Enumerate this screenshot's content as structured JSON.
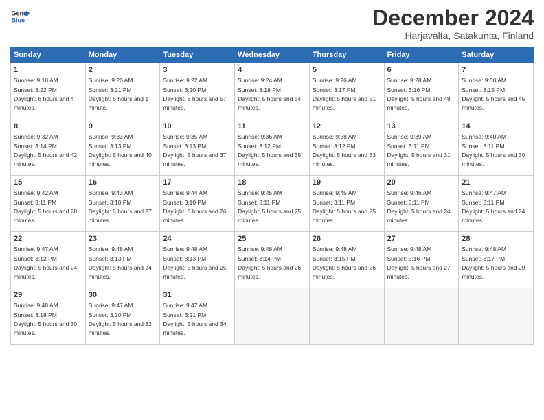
{
  "header": {
    "logo_line1": "General",
    "logo_line2": "Blue",
    "month_title": "December 2024",
    "location": "Harjavalta, Satakunta, Finland"
  },
  "calendar": {
    "weekdays": [
      "Sunday",
      "Monday",
      "Tuesday",
      "Wednesday",
      "Thursday",
      "Friday",
      "Saturday"
    ],
    "weeks": [
      [
        {
          "day": "1",
          "sunrise": "9:18 AM",
          "sunset": "3:22 PM",
          "daylight": "6 hours and 4 minutes."
        },
        {
          "day": "2",
          "sunrise": "9:20 AM",
          "sunset": "3:21 PM",
          "daylight": "6 hours and 1 minute."
        },
        {
          "day": "3",
          "sunrise": "9:22 AM",
          "sunset": "3:20 PM",
          "daylight": "5 hours and 57 minutes."
        },
        {
          "day": "4",
          "sunrise": "9:24 AM",
          "sunset": "3:18 PM",
          "daylight": "5 hours and 54 minutes."
        },
        {
          "day": "5",
          "sunrise": "9:26 AM",
          "sunset": "3:17 PM",
          "daylight": "5 hours and 51 minutes."
        },
        {
          "day": "6",
          "sunrise": "9:28 AM",
          "sunset": "3:16 PM",
          "daylight": "5 hours and 48 minutes."
        },
        {
          "day": "7",
          "sunrise": "9:30 AM",
          "sunset": "3:15 PM",
          "daylight": "5 hours and 45 minutes."
        }
      ],
      [
        {
          "day": "8",
          "sunrise": "9:32 AM",
          "sunset": "3:14 PM",
          "daylight": "5 hours and 42 minutes."
        },
        {
          "day": "9",
          "sunrise": "9:33 AM",
          "sunset": "3:13 PM",
          "daylight": "5 hours and 40 minutes."
        },
        {
          "day": "10",
          "sunrise": "9:35 AM",
          "sunset": "3:13 PM",
          "daylight": "5 hours and 37 minutes."
        },
        {
          "day": "11",
          "sunrise": "9:36 AM",
          "sunset": "3:12 PM",
          "daylight": "5 hours and 35 minutes."
        },
        {
          "day": "12",
          "sunrise": "9:38 AM",
          "sunset": "3:12 PM",
          "daylight": "5 hours and 33 minutes."
        },
        {
          "day": "13",
          "sunrise": "9:39 AM",
          "sunset": "3:11 PM",
          "daylight": "5 hours and 31 minutes."
        },
        {
          "day": "14",
          "sunrise": "9:40 AM",
          "sunset": "3:11 PM",
          "daylight": "5 hours and 30 minutes."
        }
      ],
      [
        {
          "day": "15",
          "sunrise": "9:42 AM",
          "sunset": "3:11 PM",
          "daylight": "5 hours and 28 minutes."
        },
        {
          "day": "16",
          "sunrise": "9:43 AM",
          "sunset": "3:10 PM",
          "daylight": "5 hours and 27 minutes."
        },
        {
          "day": "17",
          "sunrise": "9:44 AM",
          "sunset": "3:10 PM",
          "daylight": "5 hours and 26 minutes."
        },
        {
          "day": "18",
          "sunrise": "9:45 AM",
          "sunset": "3:11 PM",
          "daylight": "5 hours and 25 minutes."
        },
        {
          "day": "19",
          "sunrise": "9:45 AM",
          "sunset": "3:11 PM",
          "daylight": "5 hours and 25 minutes."
        },
        {
          "day": "20",
          "sunrise": "9:46 AM",
          "sunset": "3:11 PM",
          "daylight": "5 hours and 24 minutes."
        },
        {
          "day": "21",
          "sunrise": "9:47 AM",
          "sunset": "3:11 PM",
          "daylight": "5 hours and 24 minutes."
        }
      ],
      [
        {
          "day": "22",
          "sunrise": "9:47 AM",
          "sunset": "3:12 PM",
          "daylight": "5 hours and 24 minutes."
        },
        {
          "day": "23",
          "sunrise": "9:48 AM",
          "sunset": "3:13 PM",
          "daylight": "5 hours and 24 minutes."
        },
        {
          "day": "24",
          "sunrise": "9:48 AM",
          "sunset": "3:13 PM",
          "daylight": "5 hours and 25 minutes."
        },
        {
          "day": "25",
          "sunrise": "9:48 AM",
          "sunset": "3:14 PM",
          "daylight": "5 hours and 26 minutes."
        },
        {
          "day": "26",
          "sunrise": "9:48 AM",
          "sunset": "3:15 PM",
          "daylight": "5 hours and 26 minutes."
        },
        {
          "day": "27",
          "sunrise": "9:48 AM",
          "sunset": "3:16 PM",
          "daylight": "5 hours and 27 minutes."
        },
        {
          "day": "28",
          "sunrise": "9:48 AM",
          "sunset": "3:17 PM",
          "daylight": "5 hours and 29 minutes."
        }
      ],
      [
        {
          "day": "29",
          "sunrise": "9:48 AM",
          "sunset": "3:18 PM",
          "daylight": "5 hours and 30 minutes."
        },
        {
          "day": "30",
          "sunrise": "9:47 AM",
          "sunset": "3:20 PM",
          "daylight": "5 hours and 32 minutes."
        },
        {
          "day": "31",
          "sunrise": "9:47 AM",
          "sunset": "3:21 PM",
          "daylight": "5 hours and 34 minutes."
        },
        null,
        null,
        null,
        null
      ]
    ]
  }
}
